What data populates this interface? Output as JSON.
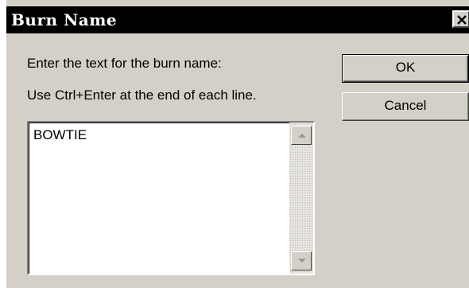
{
  "window": {
    "title": "Burn Name",
    "close_icon": "close-x-icon"
  },
  "labels": {
    "line1": "Enter the text for the burn name:",
    "line2": "Use Ctrl+Enter at the end of each line."
  },
  "buttons": {
    "ok": "OK",
    "cancel": "Cancel"
  },
  "burn_name_field": {
    "value": "BOWTIE"
  },
  "scrollbar": {
    "up_icon": "arrow-up-icon",
    "down_icon": "arrow-down-icon"
  },
  "colors": {
    "title_bar": "#000000",
    "dialog_face": "#d4d0c8"
  }
}
